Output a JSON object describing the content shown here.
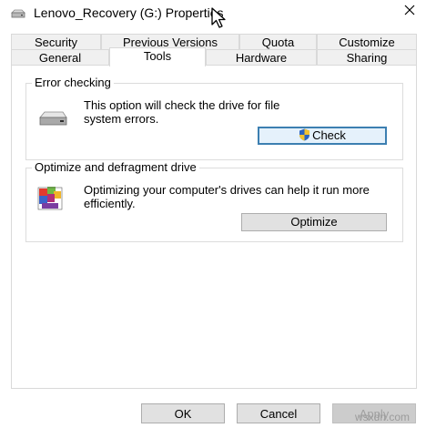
{
  "window": {
    "title": "Lenovo_Recovery (G:) Properties",
    "close_glyph": "✕"
  },
  "tabs": {
    "row1": [
      "Security",
      "Previous Versions",
      "Quota",
      "Customize"
    ],
    "row2": [
      "General",
      "Tools",
      "Hardware",
      "Sharing"
    ],
    "selected": "Tools"
  },
  "error_checking": {
    "title": "Error checking",
    "description": "This option will check the drive for file system errors.",
    "button_label": "Check",
    "icon": "drive-icon"
  },
  "optimize": {
    "title": "Optimize and defragment drive",
    "description": "Optimizing your computer's drives can help it run more efficiently.",
    "button_label": "Optimize",
    "icon": "defrag-icon"
  },
  "footer": {
    "ok_label": "OK",
    "cancel_label": "Cancel",
    "apply_label": "Apply"
  },
  "watermark": "wsxdn.com",
  "colors": {
    "focus_border": "#3c7fb1",
    "button_face": "#e1e1e1",
    "tab_inactive": "#f0f0f0"
  }
}
